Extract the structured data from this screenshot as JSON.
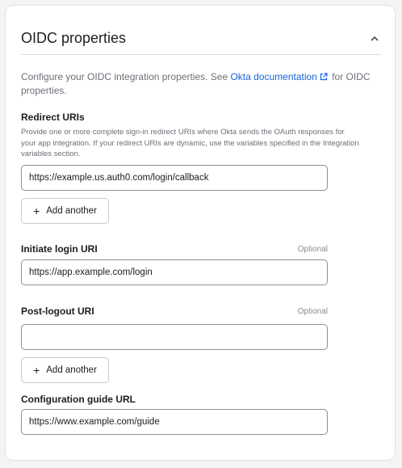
{
  "section": {
    "title": "OIDC properties",
    "intro_prefix": "Configure your OIDC integration properties. See ",
    "intro_link": "Okta documentation",
    "intro_suffix": " for OIDC properties."
  },
  "redirect_uris": {
    "label": "Redirect URIs",
    "help": "Provide one or more complete sign-in redirect URIs where Okta sends the OAuth responses for your app integration. If your redirect URIs are dynamic, use the variables specified in the Integration variables section.",
    "value": "https://example.us.auth0.com/login/callback",
    "add_label": "Add another"
  },
  "initiate_login": {
    "label": "Initiate login URI",
    "optional": "Optional",
    "value": "https://app.example.com/login"
  },
  "post_logout": {
    "label": "Post-logout URI",
    "optional": "Optional",
    "value": "",
    "add_label": "Add another"
  },
  "config_guide": {
    "label": "Configuration guide URL",
    "value": "https://www.example.com/guide"
  },
  "icons": {
    "collapse": "chevron-up-icon",
    "external": "external-link-icon",
    "add": "plus-icon"
  },
  "colors": {
    "link": "#1662dd",
    "text": "#1d1d21",
    "muted": "#6e6e78"
  }
}
